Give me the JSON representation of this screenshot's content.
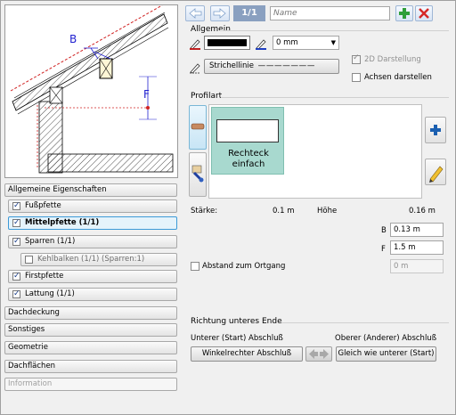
{
  "preview": {
    "label_b": "B",
    "label_f": "F"
  },
  "nav": {
    "header": "Allgemeine Eigenschaften",
    "items": [
      {
        "label": "Fußpfette",
        "checked": true
      },
      {
        "label": "Mittelpfette (1/1)",
        "checked": true
      },
      {
        "label": "Sparren (1/1)",
        "checked": true
      },
      {
        "label": "Kehlbalken (1/1) (Sparren:1)",
        "checked": false
      },
      {
        "label": "Firstpfette",
        "checked": true
      },
      {
        "label": "Lattung (1/1)",
        "checked": true
      }
    ],
    "sections": [
      "Dachdeckung",
      "Sonstiges",
      "Geometrie",
      "Dachflächen",
      "Information"
    ]
  },
  "toolbar": {
    "counter": "1/1",
    "name_placeholder": "Name"
  },
  "allgemein": {
    "title": "Allgemein",
    "pen_value": "0 mm",
    "linetype": "Strichellinie",
    "linetype_dash": "— — — — — — —",
    "darstellung_2d": "2D Darstellung",
    "achsen": "Achsen darstellen"
  },
  "profilart": {
    "title": "Profilart",
    "shape_label": "Rechteck einfach"
  },
  "dims": {
    "staerke_label": "Stärke:",
    "staerke_value": "0.1 m",
    "hoehe_label": "Höhe",
    "hoehe_value": "0.16 m",
    "b_label": "B",
    "b_value": "0.13 m",
    "f_label": "F",
    "f_value": "1.5 m",
    "ortgang_label": "Abstand zum Ortgang",
    "ortgang_value": "0 m"
  },
  "richtung": {
    "title": "Richtung unteres Ende",
    "unterer_label": "Unterer (Start) Abschluß",
    "oberer_label": "Oberer (Anderer) Abschluß",
    "unterer_btn": "Winkelrechter Abschluß",
    "oberer_btn": "Gleich wie unterer (Start)"
  },
  "colors": {
    "accent": "#3c9ad7",
    "tile_bg": "#a8d9cf",
    "plus": "#2f9e3a",
    "close": "#d62828"
  }
}
